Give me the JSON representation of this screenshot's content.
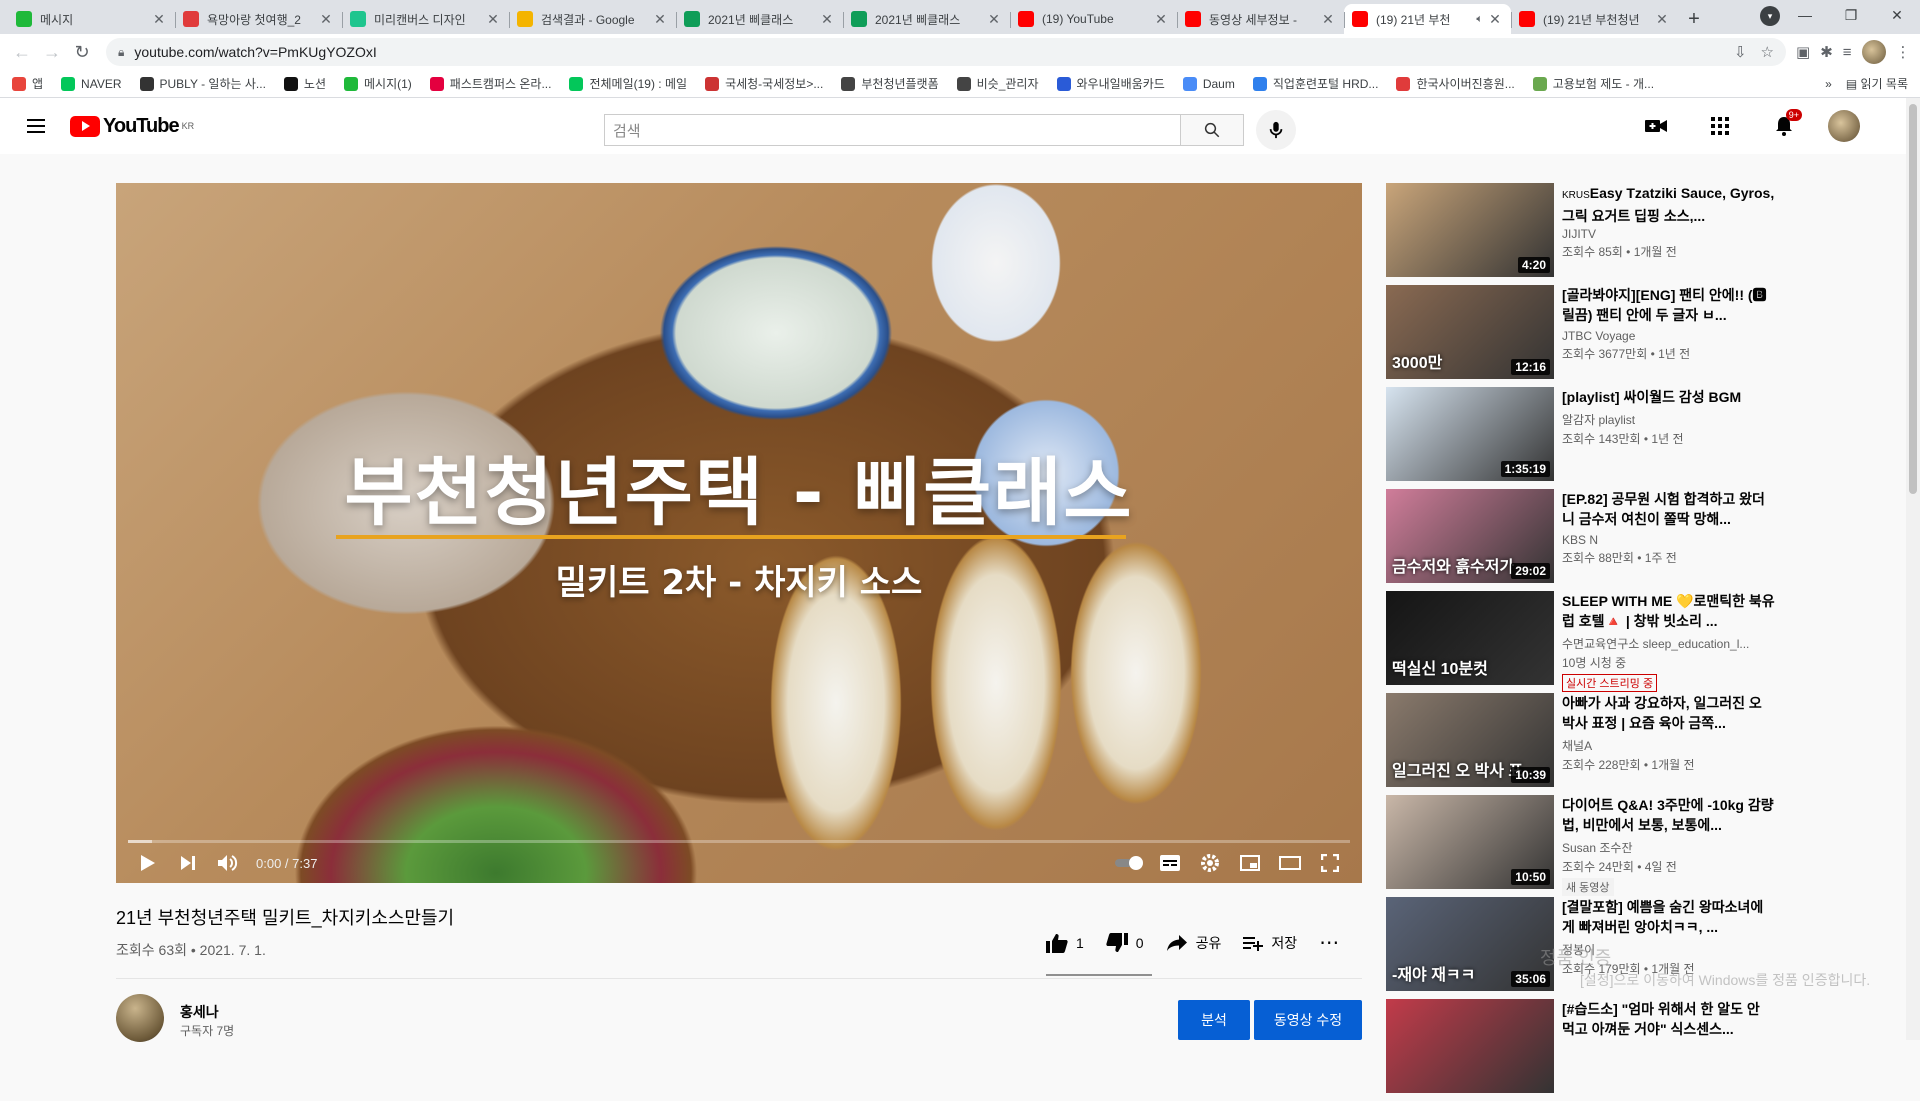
{
  "browser": {
    "tabs": [
      {
        "title": "메시지",
        "color": "#1fb93a",
        "active": false
      },
      {
        "title": "욕망아랑 첫여행_2",
        "color": "#e03b3b",
        "active": false
      },
      {
        "title": "미리캔버스 디자인",
        "color": "#1fc58e",
        "active": false
      },
      {
        "title": "검색결과 - Google",
        "color": "#f4b400",
        "active": false
      },
      {
        "title": "2021년 삐클래스",
        "color": "#0f9d58",
        "active": false
      },
      {
        "title": "2021년 삐클래스",
        "color": "#0f9d58",
        "active": false
      },
      {
        "title": "(19) YouTube",
        "color": "#ff0000",
        "active": false
      },
      {
        "title": "동영상 세부정보 -",
        "color": "#ff0000",
        "active": false
      },
      {
        "title": "(19) 21년 부천",
        "color": "#ff0000",
        "active": true
      },
      {
        "title": "(19) 21년 부천청년",
        "color": "#ff0000",
        "active": false
      }
    ],
    "url": "youtube.com/watch?v=PmKUgYOZOxI",
    "bookmarks": [
      {
        "label": "앱",
        "color": "#e8453c"
      },
      {
        "label": "NAVER",
        "color": "#03c75a"
      },
      {
        "label": "PUBLY - 일하는 사...",
        "color": "#333333"
      },
      {
        "label": "노션",
        "color": "#111111"
      },
      {
        "label": "메시지(1)",
        "color": "#1fb93a"
      },
      {
        "label": "패스트캠퍼스 온라...",
        "color": "#e4003f"
      },
      {
        "label": "전체메일(19) : 메일",
        "color": "#03c75a"
      },
      {
        "label": "국세청-국세정보>...",
        "color": "#cc3333"
      },
      {
        "label": "부천청년플랫폼",
        "color": "#444444"
      },
      {
        "label": "비슷_관리자",
        "color": "#444444"
      },
      {
        "label": "와우내일배움카드",
        "color": "#2a5bd7"
      },
      {
        "label": "Daum",
        "color": "#4a8cf7"
      },
      {
        "label": "직업훈련포털 HRD...",
        "color": "#2f80ed"
      },
      {
        "label": "한국사이버진흥원...",
        "color": "#e03b3b"
      },
      {
        "label": "고용보험 제도 - 개...",
        "color": "#6aa84f"
      }
    ],
    "bookmarks_more": "»",
    "reading_list": "읽기 목록"
  },
  "youtube": {
    "logo_text": "YouTube",
    "country": "KR",
    "search_placeholder": "검색",
    "notification_count": "9+",
    "video": {
      "overlay_title": "부천청년주택 - 삐클래스",
      "overlay_subtitle": "밀키트 2차 - 차지키 소스",
      "time": "0:00 / 7:37",
      "progress": 0,
      "buffered": 0.02,
      "title": "21년 부천청년주택 밀키트_차지키소스만들기",
      "views_date": "조회수 63회 • 2021. 7. 1.",
      "likes": "1",
      "dislikes": "0",
      "share": "공유",
      "save": "저장"
    },
    "channel": {
      "name": "홍세나",
      "subscribers": "구독자 7명"
    },
    "buttons": {
      "analytics": "분석",
      "edit_video": "동영상 수정"
    },
    "recommendations": [
      {
        "title": "Easy Tzatziki Sauce, Gyros, 그릭 요거트 딥핑 소스,...",
        "prefix": "KRUS",
        "channel": "JIJITV",
        "stats": "조회수 85회 • 1개월 전",
        "duration": "4:20",
        "bg": "#c9a57a",
        "caption": ""
      },
      {
        "title": "[골라봐야지][ENG] 팬티 안에!! (🅱릴끔) 팬티 안에 두 글자 ㅂ...",
        "prefix": "",
        "channel": "JTBC Voyage",
        "stats": "조회수 3677만회 • 1년 전",
        "duration": "12:16",
        "bg": "#8a6a52",
        "caption": "3000만"
      },
      {
        "title": "[playlist] 싸이월드 감성 BGM",
        "prefix": "",
        "channel": "알감자 playlist",
        "stats": "조회수 143만회 • 1년 전",
        "duration": "1:35:19",
        "bg": "#d6e3ef",
        "caption": ""
      },
      {
        "title": "[EP.82] 공무원 시험 합격하고 왔더니 금수저 여친이 쫄딱 망해...",
        "prefix": "",
        "channel": "KBS N",
        "stats": "조회수 88만회 • 1주 전",
        "duration": "29:02",
        "bg": "#d07d9a",
        "caption": "금수저와 흙수저가"
      },
      {
        "title": "SLEEP WITH ME 💛로맨틱한 북유럽 호텔🔺 | 창밖 빗소리 ...",
        "prefix": "",
        "channel": "수면교육연구소 sleep_education_l...",
        "stats": "10명 시청 중",
        "duration": "",
        "bg": "#151515",
        "caption": "떡실신 10분컷",
        "live": "실시간 스트리밍 중"
      },
      {
        "title": "아빠가 사과 강요하자, 일그러진 오 박사 표정 | 요즘 육아 금쪽...",
        "prefix": "",
        "channel": "채널A",
        "stats": "조회수 228만회 • 1개월 전",
        "duration": "10:39",
        "bg": "#8a7a6c",
        "caption": "일그러진 오 박사 표"
      },
      {
        "title": "다이어트 Q&A! 3주만에 -10kg 감량법, 비만에서 보통, 보통에...",
        "prefix": "",
        "channel": "Susan 조수잔",
        "stats": "조회수 24만회 • 4일 전",
        "duration": "10:50",
        "bg": "#c9b7a8",
        "caption": "",
        "new": "새 동영상"
      },
      {
        "title": "[결말포함] 예쁨을 숨긴 왕따소녀에게 빠져버린 앙아치ㅋㅋ, ...",
        "prefix": "",
        "channel": "정봉이",
        "stats": "조회수 179만회 • 1개월 전",
        "duration": "35:06",
        "bg": "#5a6478",
        "caption": "-재야 재ㅋㅋ"
      },
      {
        "title": "[#습드소] \"엄마 위해서 한 알도 안 먹고 아껴둔 거야\" 식스센스...",
        "prefix": "",
        "channel": "",
        "stats": "",
        "duration": "",
        "bg": "#c23b4a",
        "caption": ""
      }
    ],
    "watermark_line1": "정품 인증",
    "watermark_line2": "[설정]으로 이동하여 Windows를 정품 인증합니다."
  }
}
